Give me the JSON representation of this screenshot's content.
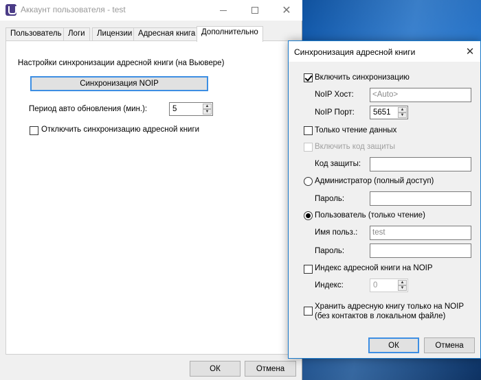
{
  "main_window": {
    "title": "Аккаунт пользователя - test",
    "tabs": [
      {
        "label": "Пользователь"
      },
      {
        "label": "Логи"
      },
      {
        "label": "Лицензии"
      },
      {
        "label": "Адресная книга"
      },
      {
        "label": "Дополнительно"
      }
    ],
    "active_tab": "Дополнительно",
    "section_title": "Настройки синхронизации адресной книги (на Вьювере)",
    "sync_button": "Синхронизация NOIP",
    "period_label": "Период авто обновления (мин.):",
    "period_value": "5",
    "disable_sync_label": "Отключить синхронизацию адресной книги",
    "disable_sync_checked": false,
    "ok": "ОК",
    "cancel": "Отмена"
  },
  "dialog": {
    "title": "Синхронизация адресной книги",
    "enable_sync_label": "Включить синхронизацию",
    "enable_sync_checked": true,
    "noip_host_label": "NoIP Хост:",
    "noip_host_placeholder": "<Auto>",
    "noip_port_label": "NoIP Порт:",
    "noip_port_value": "5651",
    "readonly_label": "Только чтение данных",
    "enable_code_label": "Включить код защиты",
    "code_label": "Код защиты:",
    "code_value": "",
    "admin_label": "Администратор (полный доступ)",
    "admin_password_label": "Пароль:",
    "user_label": "Пользователь (только чтение)",
    "user_selected": true,
    "username_label": "Имя польз.:",
    "username_value": "test",
    "user_password_label": "Пароль:",
    "index_on_noip_label": "Индекс адресной книги на NOIP",
    "index_label": "Индекс:",
    "index_value": "0",
    "store_only_label_line1": "Хранить адресную книгу только на NOIP",
    "store_only_label_line2": "(без контактов в локальном файле)",
    "ok": "ОК",
    "cancel": "Отмена"
  },
  "colors": {
    "accent": "#3c8ee3",
    "dialog_border": "#1979ca",
    "app_icon": "#4b3c87"
  }
}
